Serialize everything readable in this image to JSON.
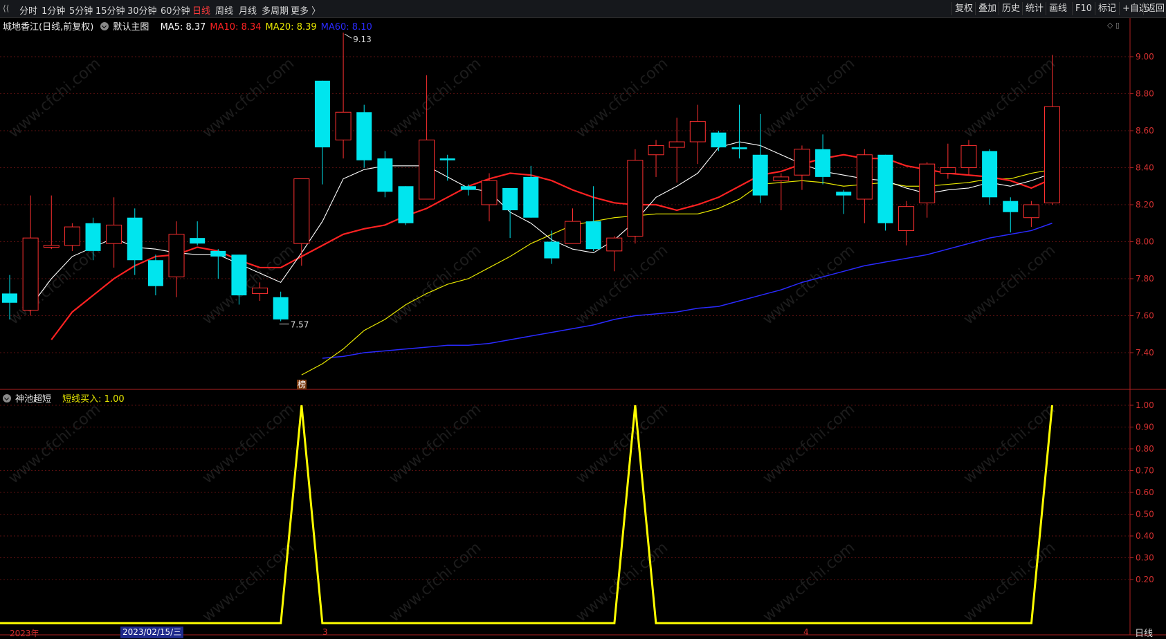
{
  "toolbar": {
    "back_icon": "back-arrow-icon",
    "periods": [
      "分时",
      "1分钟",
      "5分钟",
      "15分钟",
      "30分钟",
      "60分钟",
      "日线",
      "周线",
      "月线",
      "多周期",
      "更多 〉"
    ],
    "active_period": "日线",
    "right_buttons": [
      "复权",
      "叠加",
      "历史",
      "统计",
      "画线",
      "F10",
      "标记",
      "+自选",
      "返回"
    ]
  },
  "main_chart": {
    "stock_name": "城地香江(日线,前复权)",
    "template": "默认主图",
    "ma": [
      {
        "label": "MA5: 8.37",
        "color": "#ffffff"
      },
      {
        "label": "MA10: 8.34",
        "color": "#ff2222"
      },
      {
        "label": "MA20: 8.39",
        "color": "#e6e600"
      },
      {
        "label": "MA60: 8.10",
        "color": "#2a2aff"
      }
    ],
    "high_label": "9.13",
    "low_label": "7.57",
    "badge": "榜"
  },
  "sub_chart": {
    "name": "神池超短",
    "indicator": "短线买入: 1.00"
  },
  "x_axis": {
    "date_start": "2023年",
    "selected_date": "2023/02/15/三",
    "month_3": "3",
    "month_4": "4"
  },
  "period_corner": "日线",
  "watermark": "www.cfchi.com",
  "colors": {
    "up": "#ff3030",
    "down": "#00e5ee",
    "ma5": "#ffffff",
    "ma10": "#ff2222",
    "ma20": "#e6e600",
    "ma60": "#2a2aff",
    "signal": "#ffff00"
  },
  "chart_data": [
    {
      "type": "candlestick",
      "ylim": [
        7.3,
        9.1
      ],
      "y_ticks": [
        "9.00",
        "8.80",
        "8.60",
        "8.40",
        "8.20",
        "8.00",
        "7.80",
        "7.60",
        "7.40"
      ],
      "candles": [
        {
          "o": 7.72,
          "c": 7.67,
          "h": 7.82,
          "l": 7.58
        },
        {
          "o": 7.63,
          "c": 8.02,
          "h": 8.25,
          "l": 7.6
        },
        {
          "o": 7.97,
          "c": 7.98,
          "h": 8.25,
          "l": 7.96
        },
        {
          "o": 7.98,
          "c": 8.08,
          "h": 8.1,
          "l": 7.95
        },
        {
          "o": 8.1,
          "c": 7.95,
          "h": 8.13,
          "l": 7.9
        },
        {
          "o": 7.99,
          "c": 8.09,
          "h": 8.24,
          "l": 7.86
        },
        {
          "o": 8.13,
          "c": 7.9,
          "h": 8.18,
          "l": 7.82
        },
        {
          "o": 7.9,
          "c": 7.76,
          "h": 7.93,
          "l": 7.71
        },
        {
          "o": 7.81,
          "c": 8.04,
          "h": 8.11,
          "l": 7.7
        },
        {
          "o": 8.02,
          "c": 7.99,
          "h": 8.11,
          "l": 7.98
        },
        {
          "o": 7.95,
          "c": 7.92,
          "h": 7.96,
          "l": 7.8
        },
        {
          "o": 7.93,
          "c": 7.71,
          "h": 7.93,
          "l": 7.66
        },
        {
          "o": 7.72,
          "c": 7.75,
          "h": 7.78,
          "l": 7.68
        },
        {
          "o": 7.7,
          "c": 7.58,
          "h": 7.73,
          "l": 7.57
        },
        {
          "o": 7.99,
          "c": 8.34,
          "h": 8.34,
          "l": 7.87
        },
        {
          "o": 8.87,
          "c": 8.51,
          "h": 8.87,
          "l": 8.31
        },
        {
          "o": 8.55,
          "c": 8.7,
          "h": 9.13,
          "l": 8.45
        },
        {
          "o": 8.7,
          "c": 8.44,
          "h": 8.74,
          "l": 8.4
        },
        {
          "o": 8.45,
          "c": 8.27,
          "h": 8.49,
          "l": 8.24
        },
        {
          "o": 8.3,
          "c": 8.1,
          "h": 8.3,
          "l": 8.09
        },
        {
          "o": 8.23,
          "c": 8.55,
          "h": 8.9,
          "l": 8.23
        },
        {
          "o": 8.45,
          "c": 8.44,
          "h": 8.47,
          "l": 8.33
        },
        {
          "o": 8.3,
          "c": 8.28,
          "h": 8.31,
          "l": 8.25
        },
        {
          "o": 8.2,
          "c": 8.33,
          "h": 8.37,
          "l": 8.11
        },
        {
          "o": 8.29,
          "c": 8.17,
          "h": 8.29,
          "l": 8.02
        },
        {
          "o": 8.35,
          "c": 8.13,
          "h": 8.41,
          "l": 8.13
        },
        {
          "o": 8.0,
          "c": 7.91,
          "h": 8.06,
          "l": 7.88
        },
        {
          "o": 7.99,
          "c": 8.11,
          "h": 8.18,
          "l": 7.99
        },
        {
          "o": 8.11,
          "c": 7.96,
          "h": 8.3,
          "l": 7.95
        },
        {
          "o": 7.95,
          "c": 8.02,
          "h": 8.03,
          "l": 7.84
        },
        {
          "o": 8.03,
          "c": 8.44,
          "h": 8.5,
          "l": 7.99
        },
        {
          "o": 8.47,
          "c": 8.52,
          "h": 8.55,
          "l": 8.35
        },
        {
          "o": 8.51,
          "c": 8.54,
          "h": 8.67,
          "l": 8.32
        },
        {
          "o": 8.54,
          "c": 8.65,
          "h": 8.74,
          "l": 8.42
        },
        {
          "o": 8.59,
          "c": 8.51,
          "h": 8.6,
          "l": 8.49
        },
        {
          "o": 8.51,
          "c": 8.5,
          "h": 8.74,
          "l": 8.45
        },
        {
          "o": 8.47,
          "c": 8.25,
          "h": 8.69,
          "l": 8.21
        },
        {
          "o": 8.33,
          "c": 8.35,
          "h": 8.37,
          "l": 8.17
        },
        {
          "o": 8.36,
          "c": 8.5,
          "h": 8.52,
          "l": 8.28
        },
        {
          "o": 8.5,
          "c": 8.35,
          "h": 8.58,
          "l": 8.31
        },
        {
          "o": 8.27,
          "c": 8.25,
          "h": 8.28,
          "l": 8.15
        },
        {
          "o": 8.23,
          "c": 8.47,
          "h": 8.5,
          "l": 8.1
        },
        {
          "o": 8.47,
          "c": 8.1,
          "h": 8.47,
          "l": 8.06
        },
        {
          "o": 8.06,
          "c": 8.19,
          "h": 8.22,
          "l": 7.98
        },
        {
          "o": 8.21,
          "c": 8.42,
          "h": 8.43,
          "l": 8.13
        },
        {
          "o": 8.37,
          "c": 8.4,
          "h": 8.53,
          "l": 8.34
        },
        {
          "o": 8.4,
          "c": 8.52,
          "h": 8.55,
          "l": 8.36
        },
        {
          "o": 8.49,
          "c": 8.24,
          "h": 8.5,
          "l": 8.2
        },
        {
          "o": 8.22,
          "c": 8.16,
          "h": 8.24,
          "l": 8.05
        },
        {
          "o": 8.13,
          "c": 8.2,
          "h": 8.22,
          "l": 8.08
        },
        {
          "o": 8.21,
          "c": 8.73,
          "h": 9.01,
          "l": 8.2
        }
      ],
      "ma5": [
        7.65,
        7.8,
        7.92,
        7.97,
        8.02,
        7.97,
        7.96,
        7.94,
        7.93,
        7.93,
        7.88,
        7.83,
        7.78,
        7.94,
        8.11,
        8.34,
        8.39,
        8.41,
        8.41,
        8.41,
        8.35,
        8.29,
        8.27,
        8.16,
        8.1,
        8.01,
        7.96,
        7.94,
        8.01,
        8.11,
        8.24,
        8.3,
        8.37,
        8.51,
        8.54,
        8.52,
        8.47,
        8.42,
        8.38,
        8.36,
        8.34,
        8.33,
        8.29,
        8.26,
        8.28,
        8.29,
        8.32,
        8.3,
        8.33,
        8.37
      ],
      "ma10": [
        7.47,
        7.62,
        7.71,
        7.8,
        7.87,
        7.92,
        7.93,
        7.97,
        7.95,
        7.9,
        7.86,
        7.86,
        7.92,
        7.98,
        8.04,
        8.07,
        8.09,
        8.14,
        8.18,
        8.24,
        8.3,
        8.34,
        8.37,
        8.36,
        8.33,
        8.28,
        8.24,
        8.21,
        8.2,
        8.2,
        8.17,
        8.2,
        8.24,
        8.3,
        8.36,
        8.38,
        8.42,
        8.45,
        8.47,
        8.45,
        8.45,
        8.41,
        8.39,
        8.37,
        8.36,
        8.35,
        8.33,
        8.29,
        8.34
      ],
      "ma20": [
        7.28,
        7.34,
        7.42,
        7.52,
        7.58,
        7.66,
        7.72,
        7.77,
        7.8,
        7.86,
        7.92,
        7.99,
        8.04,
        8.09,
        8.11,
        8.13,
        8.14,
        8.15,
        8.15,
        8.15,
        8.18,
        8.23,
        8.31,
        8.32,
        8.33,
        8.32,
        8.3,
        8.31,
        8.32,
        8.3,
        8.3,
        8.31,
        8.32,
        8.34,
        8.34,
        8.37,
        8.39
      ],
      "ma60": [
        7.37,
        7.38,
        7.4,
        7.41,
        7.42,
        7.43,
        7.44,
        7.44,
        7.45,
        7.47,
        7.49,
        7.51,
        7.53,
        7.55,
        7.58,
        7.6,
        7.61,
        7.62,
        7.64,
        7.65,
        7.68,
        7.71,
        7.74,
        7.78,
        7.81,
        7.84,
        7.87,
        7.89,
        7.91,
        7.93,
        7.96,
        7.99,
        8.02,
        8.04,
        8.06,
        8.1
      ]
    },
    {
      "type": "line",
      "series": [
        {
          "name": "短线买入",
          "values": [
            0,
            0,
            0,
            0,
            0,
            0,
            0,
            0,
            0,
            0,
            0,
            0,
            0,
            0,
            1,
            0,
            0,
            0,
            0,
            0,
            0,
            0,
            0,
            0,
            0,
            0,
            0,
            0,
            0,
            0,
            1,
            0,
            0,
            0,
            0,
            0,
            0,
            0,
            0,
            0,
            0,
            0,
            0,
            0,
            0,
            0,
            0,
            0,
            0,
            0,
            1
          ]
        }
      ],
      "ylim": [
        0,
        1.0
      ],
      "y_ticks": [
        "1.00",
        "0.90",
        "0.80",
        "0.70",
        "0.60",
        "0.50",
        "0.40",
        "0.30",
        "0.20"
      ]
    }
  ]
}
